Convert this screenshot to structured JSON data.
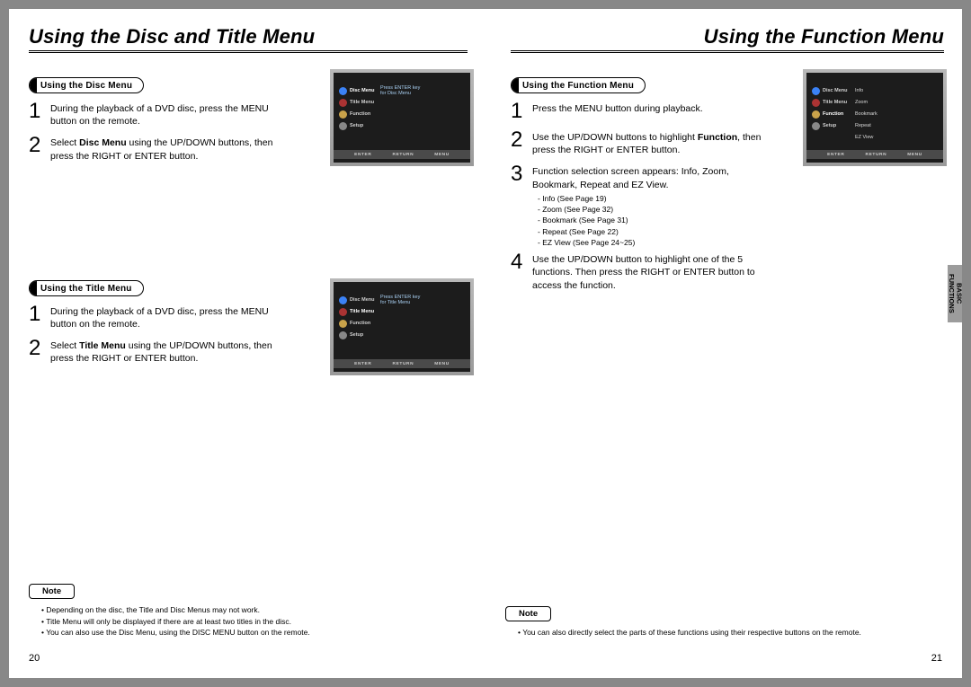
{
  "left": {
    "title": "Using the Disc and Title Menu",
    "page_num": "20",
    "disc": {
      "label": "Using the Disc Menu",
      "steps": [
        "During the playback of a DVD disc, press the MENU button on the remote.",
        "Select <b>Disc Menu</b> using the UP/DOWN buttons, then press the RIGHT or ENTER button."
      ]
    },
    "title_menu": {
      "label": "Using the Title Menu",
      "steps": [
        "During the playback of a DVD disc, press the MENU button on the remote.",
        "Select <b>Title Menu</b> using the UP/DOWN buttons, then press the RIGHT or ENTER button."
      ]
    },
    "note": {
      "label": "Note",
      "bullets": [
        "Depending on the disc, the Title and Disc Menus may not work.",
        "Title Menu will only be displayed if there are at least two titles in the disc.",
        "You can also use the Disc Menu, using the DISC MENU button on the remote."
      ]
    },
    "osd1": {
      "rows": [
        "Disc Menu",
        "Title Menu",
        "Function",
        "Setup"
      ],
      "hint1": "Press ENTER key",
      "hint2": "for Disc Menu",
      "footer": [
        "ENTER",
        "RETURN",
        "MENU"
      ]
    },
    "osd2": {
      "rows": [
        "Disc Menu",
        "Title Menu",
        "Function",
        "Setup"
      ],
      "hint1": "Press ENTER key",
      "hint2": "for Title Menu",
      "footer": [
        "ENTER",
        "RETURN",
        "MENU"
      ]
    }
  },
  "right": {
    "title": "Using the Function Menu",
    "page_num": "21",
    "func": {
      "label": "Using the Function Menu",
      "steps": [
        "Press the MENU button during playback.",
        "Use the UP/DOWN buttons to highlight <b>Function</b>, then press the RIGHT or ENTER button.",
        "Function selection screen appears: Info, Zoom, Bookmark, Repeat and EZ View.",
        "Use the UP/DOWN button to highlight one of the 5 functions. Then press the RIGHT or ENTER button to access the function."
      ],
      "subs": [
        "-  Info (See Page 19)",
        "-  Zoom (See Page 32)",
        "-  Bookmark (See Page 31)",
        "-  Repeat (See Page 22)",
        "-  EZ View (See Page 24~25)"
      ]
    },
    "note": {
      "label": "Note",
      "bullets": [
        "You can also directly select the parts of these functions using their respective buttons on the remote."
      ]
    },
    "osd": {
      "rows": [
        "Disc Menu",
        "Title Menu",
        "Function",
        "Setup"
      ],
      "subs": [
        "Info",
        "Zoom",
        "Bookmark",
        "Repeat",
        "EZ View"
      ],
      "footer": [
        "ENTER",
        "RETURN",
        "MENU"
      ]
    },
    "side_tab": "BASIC FUNCTIONS"
  }
}
